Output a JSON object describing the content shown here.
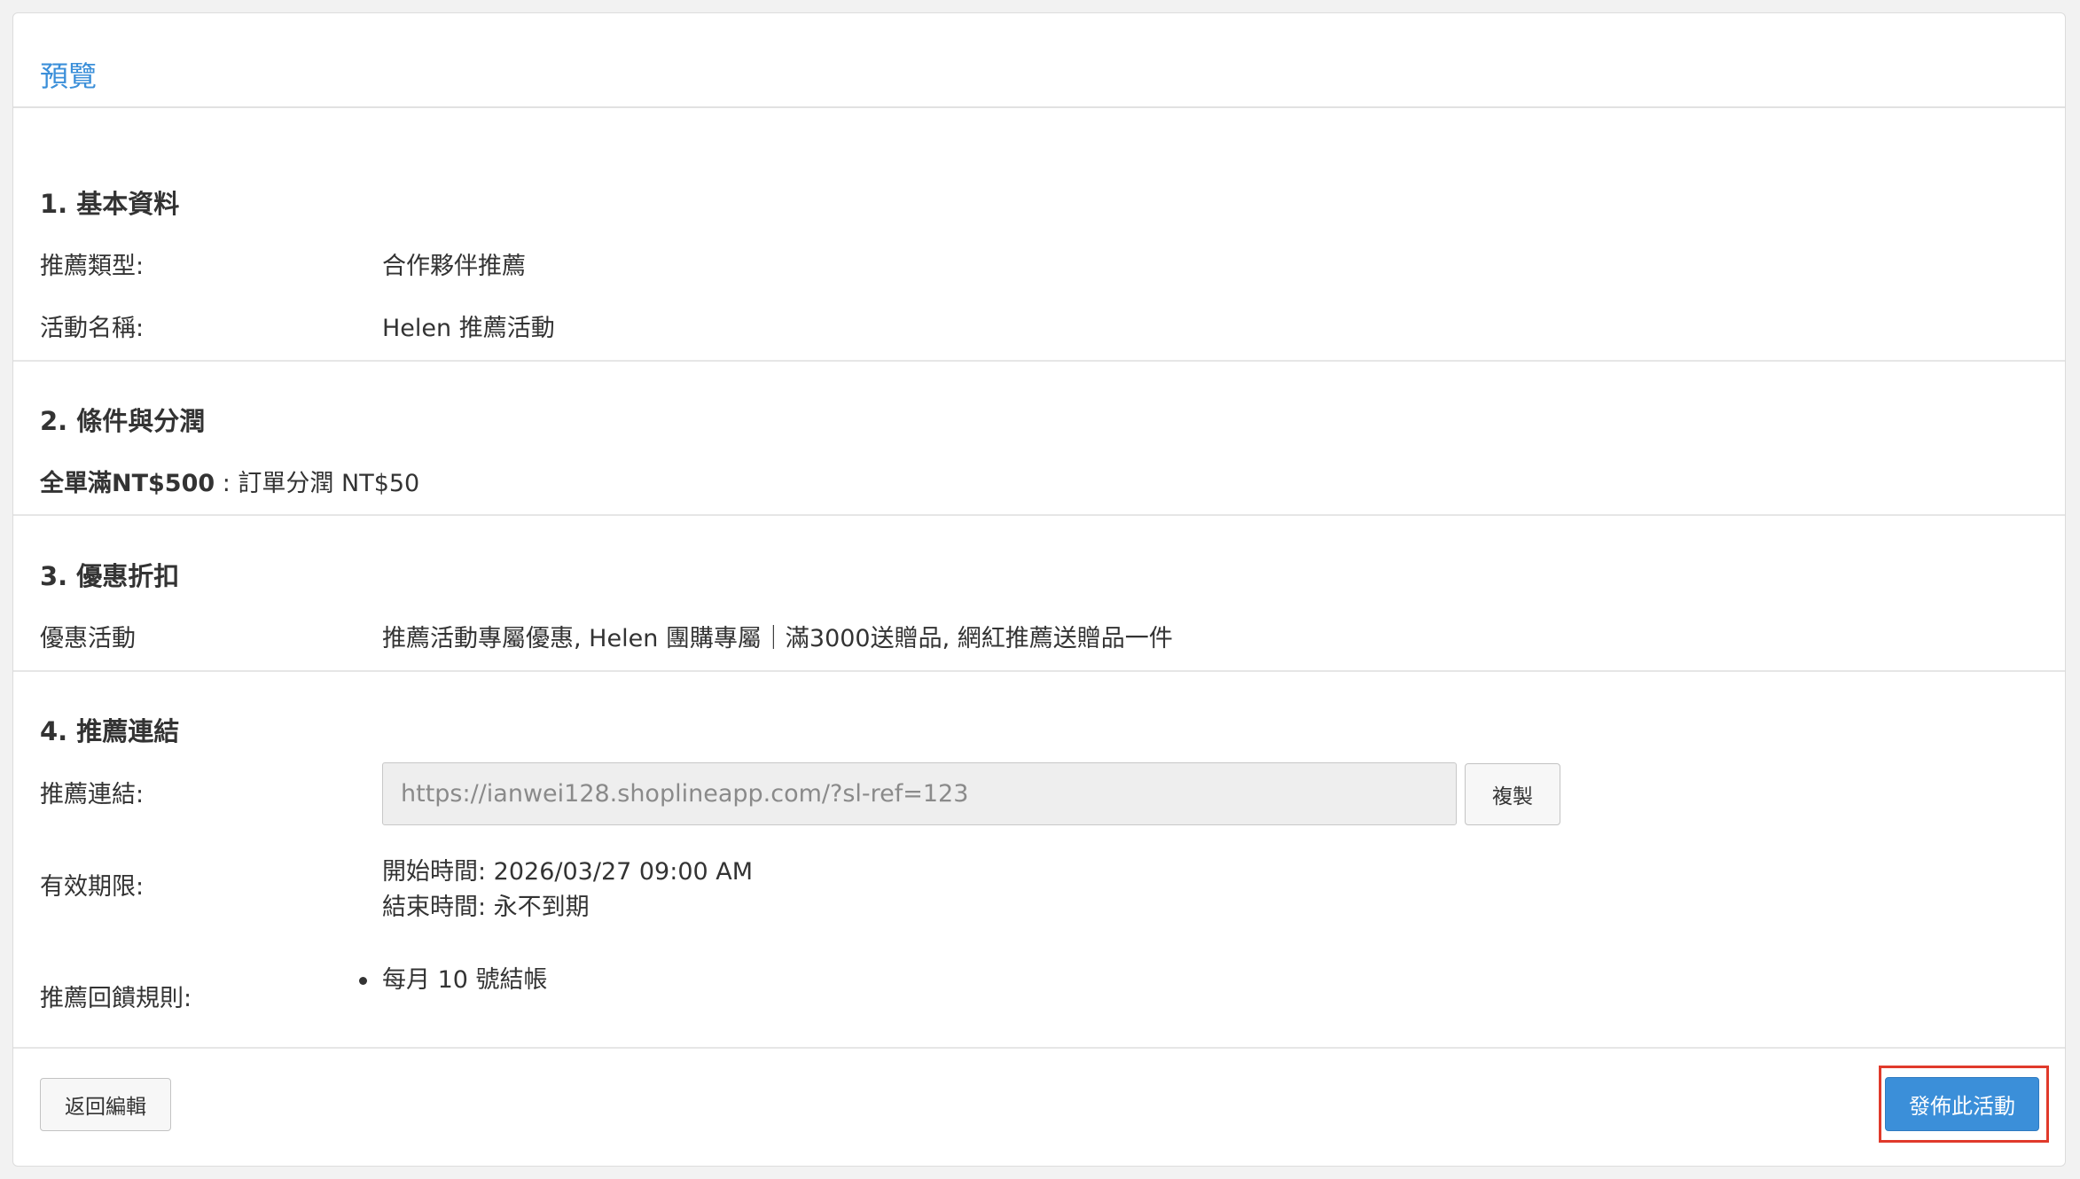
{
  "panel": {
    "title": "預覽"
  },
  "basic": {
    "title": "1. 基本資料",
    "type_label": "推薦類型:",
    "type_value": "合作夥伴推薦",
    "name_label": "活動名稱:",
    "name_value": "Helen 推薦活動"
  },
  "conditions": {
    "title": "2. 條件與分潤",
    "condition_bold": "全單滿NT$500",
    "condition_rest": " : 訂單分潤 NT$50"
  },
  "discount": {
    "title": "3. 優惠折扣",
    "label": "優惠活動",
    "value": "推薦活動專屬優惠, Helen 團購專屬｜滿3000送贈品, 網紅推薦送贈品一件"
  },
  "link": {
    "title": "4. 推薦連結",
    "link_label": "推薦連結:",
    "url": "https://ianwei128.shoplineapp.com/?sl-ref=123",
    "copy_label": "複製",
    "validity_label": "有效期限:",
    "start": "開始時間: 2026/03/27 09:00 AM",
    "end": "結束時間: 永不到期",
    "rules_label": "推薦回饋規則:",
    "rules": [
      "每月 10 號結帳"
    ]
  },
  "footer": {
    "back_label": "返回編輯",
    "publish_label": "發佈此活動"
  },
  "colors": {
    "accent": "#3b8fd9",
    "highlight": "#e03a2b"
  }
}
